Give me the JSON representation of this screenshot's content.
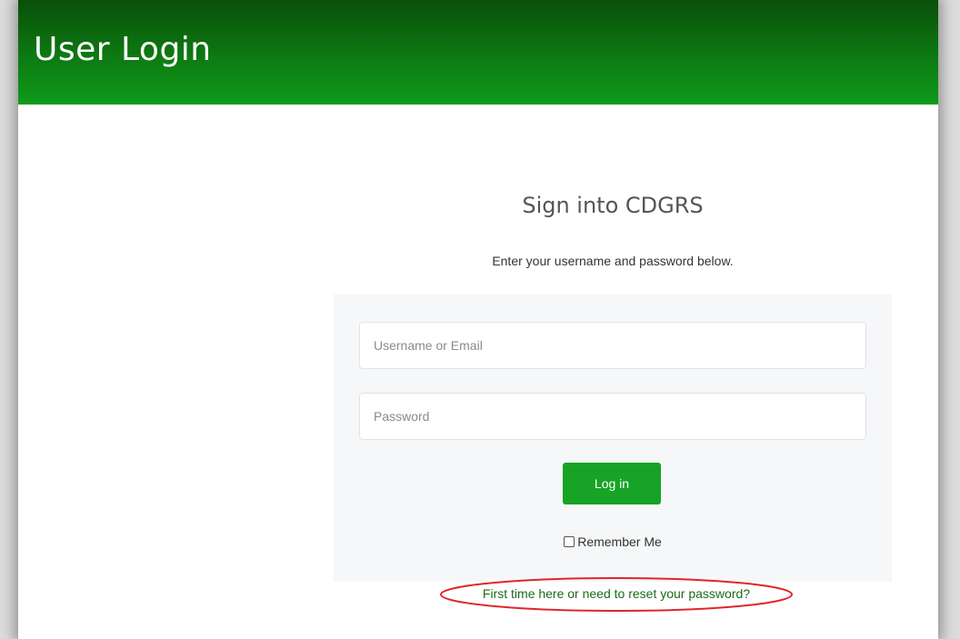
{
  "header": {
    "title": "User Login"
  },
  "login": {
    "title": "Sign into CDGRS",
    "subtitle": "Enter your username and password below.",
    "username_placeholder": "Username or Email",
    "password_placeholder": "Password",
    "login_button": "Log in",
    "remember_label": "Remember Me",
    "remember_checked": false,
    "reset_link": "First time here or need to reset your password?"
  },
  "colors": {
    "header_gradient_top": "#0a4f0a",
    "header_gradient_bottom": "#0f9b1a",
    "button": "#17a326",
    "link": "#1a6b1a",
    "annotation_ellipse": "#e0262b"
  }
}
